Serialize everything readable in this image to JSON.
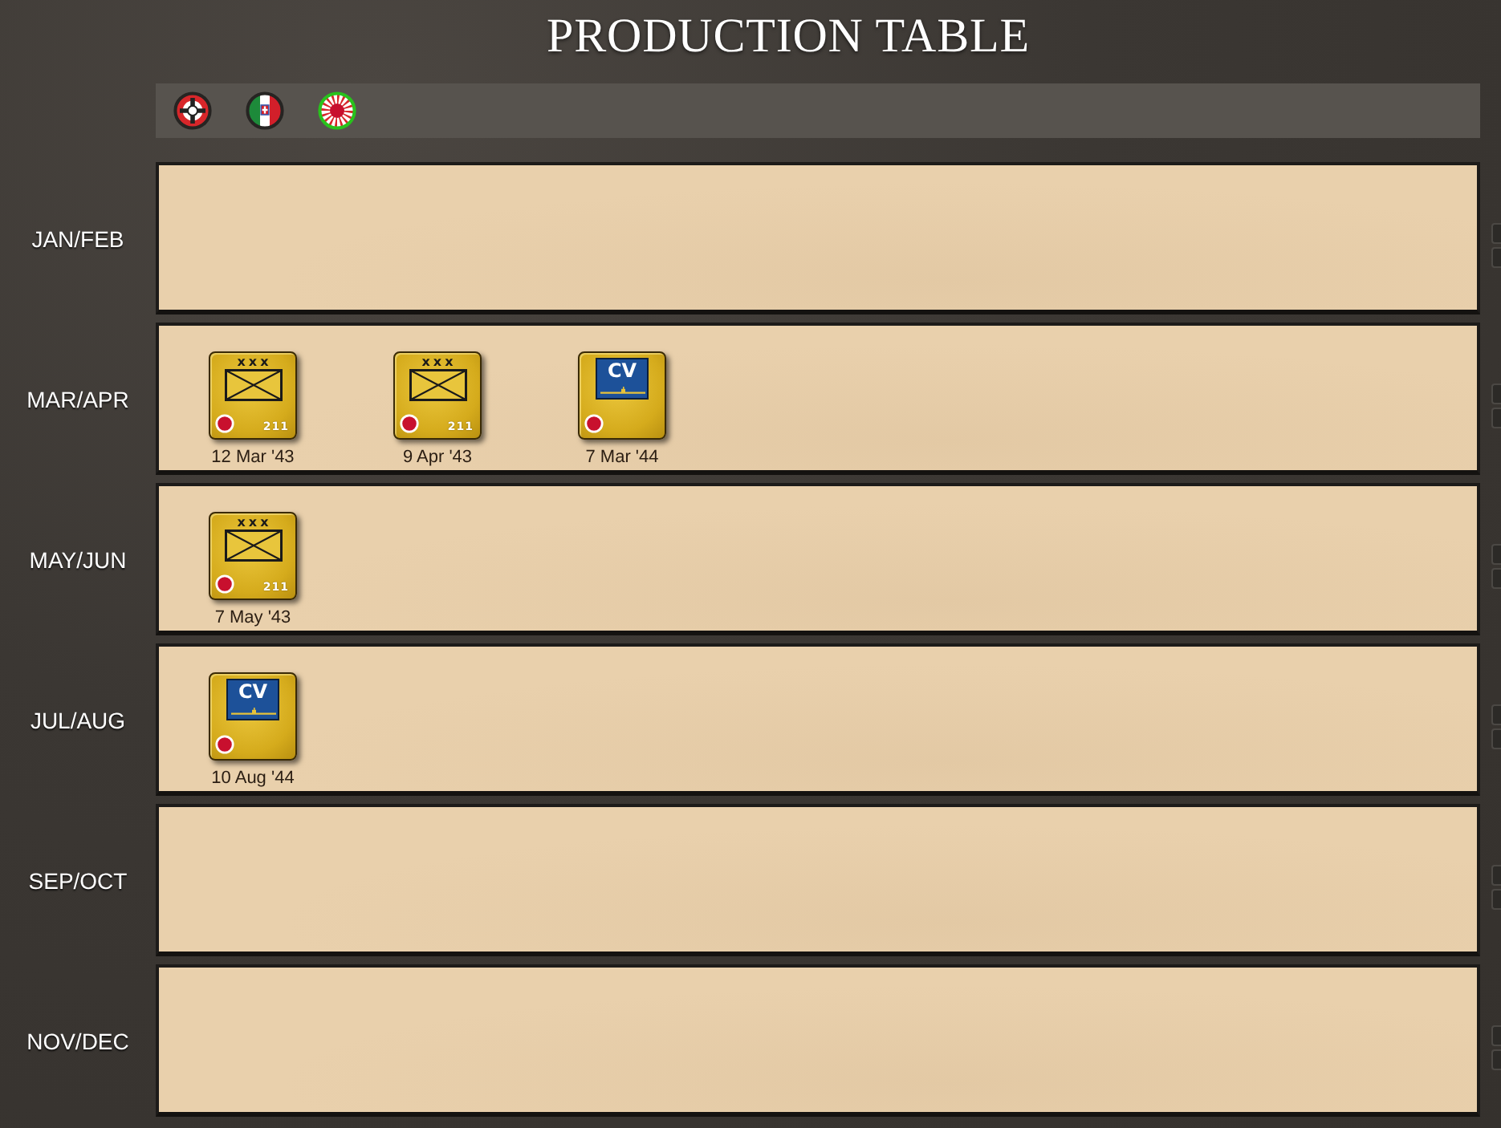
{
  "title": "PRODUCTION TABLE",
  "nations": [
    {
      "kind": "cross",
      "selected": false
    },
    {
      "kind": "tricolor",
      "selected": false
    },
    {
      "kind": "sunburst",
      "selected": true
    }
  ],
  "periods": [
    {
      "label": "JAN/FEB"
    },
    {
      "label": "MAR/APR",
      "units": [
        {
          "kind": "infantry",
          "size": "xxx",
          "number": "211",
          "date": "12 Mar '43"
        },
        {
          "kind": "infantry",
          "size": "xxx",
          "number": "211",
          "date": "9 Apr '43"
        },
        {
          "kind": "carrier",
          "type": "CV",
          "date": "7 Mar '44"
        }
      ]
    },
    {
      "label": "MAY/JUN",
      "units": [
        {
          "kind": "infantry",
          "size": "xxx",
          "number": "211",
          "date": "7 May '43"
        }
      ]
    },
    {
      "label": "JUL/AUG",
      "units": [
        {
          "kind": "carrier",
          "type": "CV",
          "date": "10 Aug '44"
        }
      ]
    },
    {
      "label": "SEP/OCT"
    },
    {
      "label": "NOV/DEC"
    }
  ]
}
